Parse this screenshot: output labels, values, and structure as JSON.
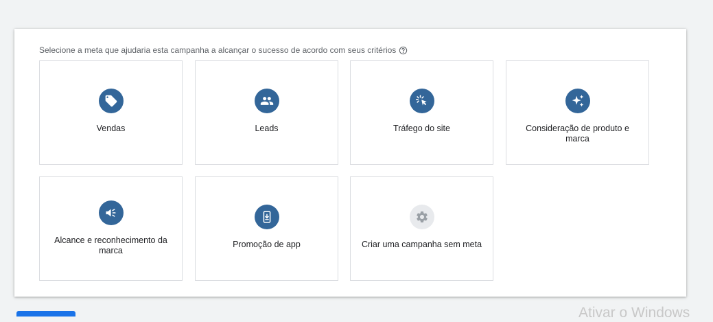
{
  "prompt": {
    "text": "Selecione a meta que ajudaria esta campanha a alcançar o sucesso de acordo com seus critérios",
    "help_icon": "help-circle-icon"
  },
  "goals": [
    {
      "label": "Vendas",
      "icon": "tag-icon"
    },
    {
      "label": "Leads",
      "icon": "people-icon"
    },
    {
      "label": "Tráfego do site",
      "icon": "cursor-click-icon"
    },
    {
      "label": "Consideração de produto e marca",
      "icon": "sparkle-icon"
    },
    {
      "label": "Alcance e reconhecimento da marca",
      "icon": "megaphone-icon"
    },
    {
      "label": "Promoção de app",
      "icon": "phone-download-icon"
    },
    {
      "label": "Criar uma campanha sem meta",
      "icon": "gear-icon"
    }
  ],
  "watermark": "Ativar o Windows",
  "colors": {
    "accent": "#336699",
    "disabled_icon_bg": "#e8eaed",
    "border": "#dadce0",
    "primary_button": "#1a73e8"
  }
}
